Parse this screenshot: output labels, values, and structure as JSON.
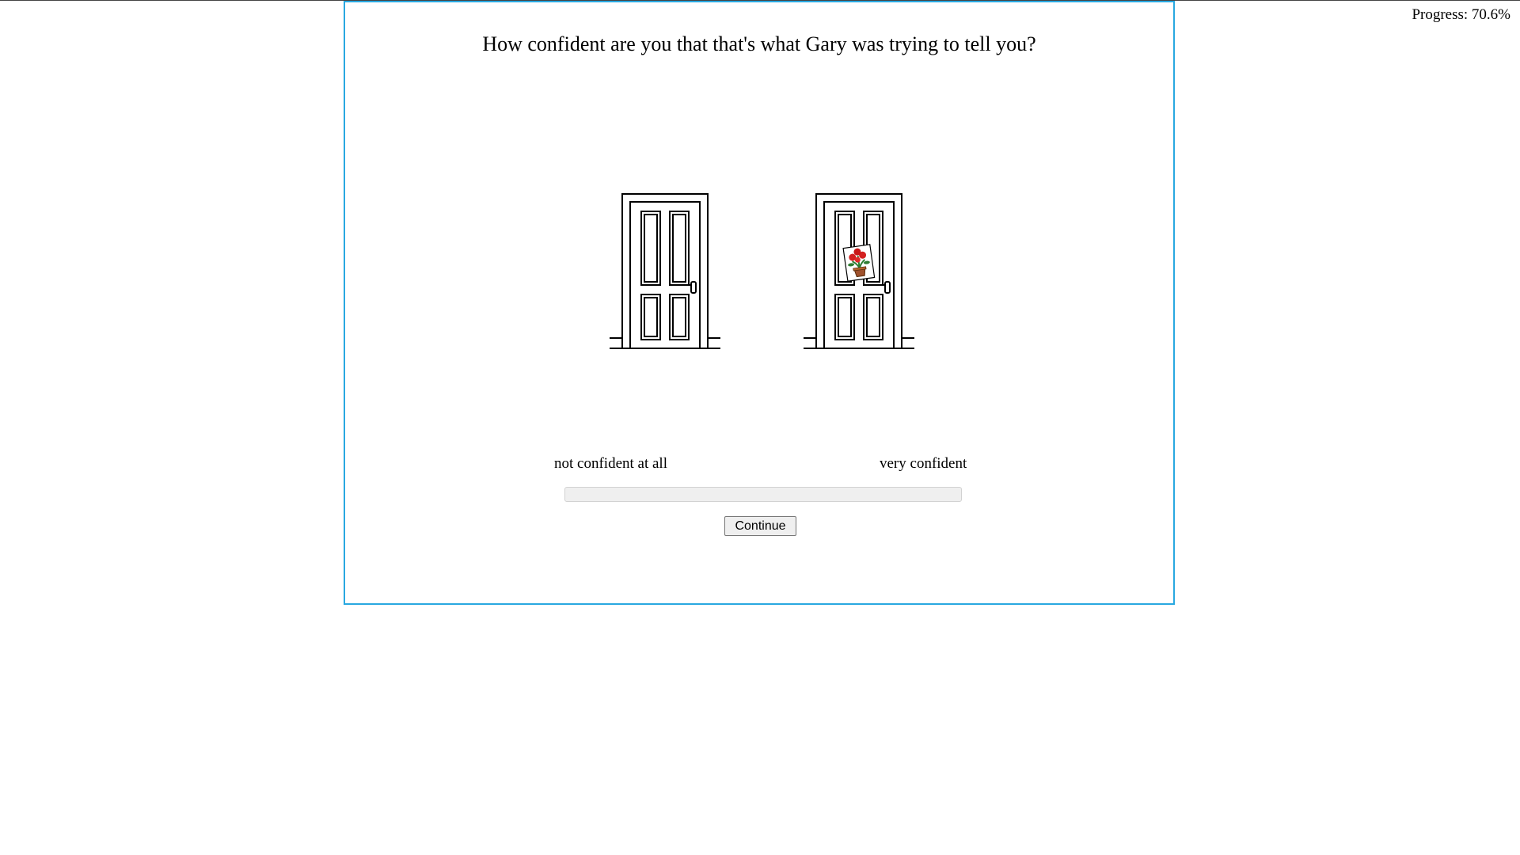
{
  "progress": {
    "label": "Progress: 70.6%",
    "value": 0.706
  },
  "question": "How confident are you that that's what Gary was trying to tell you?",
  "doors": [
    {
      "name": "plain-door",
      "sign": null
    },
    {
      "name": "door-with-flower-sign",
      "sign": "flower-pot-icon"
    }
  ],
  "scale": {
    "left_label": "not confident at all",
    "right_label": "very confident",
    "value": null
  },
  "continue_label": "Continue",
  "colors": {
    "frame_border": "#29a8e0",
    "slider_track": "#efefef",
    "button_bg": "#efefef"
  }
}
